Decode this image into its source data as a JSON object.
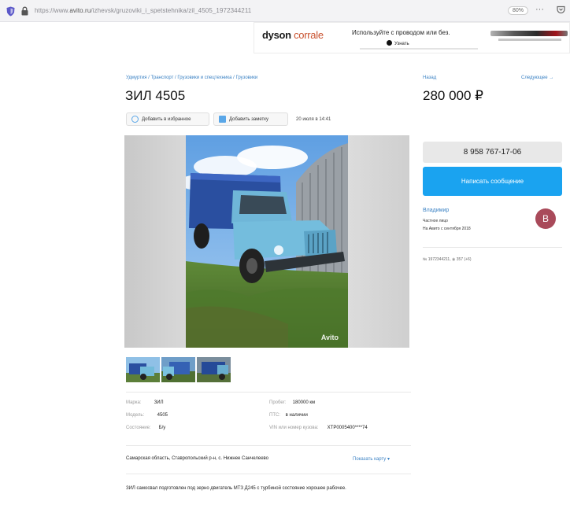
{
  "browser": {
    "url_prefix": "https://www.",
    "url_domain": "avito.ru",
    "url_path": "/izhevsk/gruzoviki_i_spetstehnika/zil_4505_1972344211",
    "zoom": "80%",
    "more_label": "···"
  },
  "ad_banner": {
    "brand": "dyson",
    "product": "corrale",
    "text": "Используйте с проводом или без.",
    "button": "Узнать"
  },
  "listing": {
    "breadcrumbs": "Удмуртия / Транспорт / Грузовики и спецтехника / Грузовики",
    "title": "ЗИЛ 4505",
    "favorite_label": "Добавить в избранное",
    "note_label": "Добавить заметку",
    "date": "20 июля в 14:41",
    "watermark": "Avito"
  },
  "nav": {
    "prev": "Назад",
    "next": "Следующее →"
  },
  "price": "280 000 ₽",
  "contact": {
    "phone": "8 958 767-17-06",
    "message_label": "Написать сообщение"
  },
  "seller": {
    "name": "Владимир",
    "type": "Частное лицо",
    "since": "На Авито с сентября 2018",
    "avatar_letter": "В"
  },
  "ad_meta": {
    "id": "№ 1972344211, ",
    "views": "357 (+6)"
  },
  "params": {
    "brand_label": "Марка:",
    "brand_value": "ЗИЛ",
    "model_label": "Модель:",
    "model_value": "4505",
    "condition_label": "Состояние:",
    "condition_value": "Б/у",
    "mileage_label": "Пробег:",
    "mileage_value": "180000 км",
    "pts_label": "ПТС:",
    "pts_value": "в наличии",
    "vin_label": "VIN или номер кузова:",
    "vin_value": "XTP0005400****74"
  },
  "address": "Самарская область, Ставропольский р-н, с. Нижнее Санчелеево",
  "map_link": "Показать карту ▾",
  "description": "ЗИЛ самосвал подготовлен под зерно двигатель МТЗ Д245 с турбиной состояние хорошее рабочее."
}
